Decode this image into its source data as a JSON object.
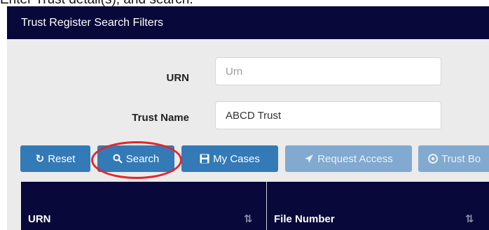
{
  "caption": "Enter Trust detail(s), and search.",
  "panel": {
    "title": "Trust Register Search Filters"
  },
  "filters": {
    "urn": {
      "label": "URN",
      "value": "",
      "placeholder": "Urn"
    },
    "trust_name": {
      "label": "Trust Name",
      "value": "ABCD Trust",
      "placeholder": ""
    }
  },
  "buttons": {
    "reset": "Reset",
    "search": "Search",
    "my_cases": "My Cases",
    "request_access": "Request Access",
    "trust_browse": "Trust Bo"
  },
  "table": {
    "columns": [
      "URN",
      "File Number"
    ]
  },
  "icons": {
    "reset": "refresh-icon",
    "search": "search-icon",
    "my_cases": "save-icon",
    "request_access": "send-icon",
    "trust_browse": "circle-icon",
    "urn_sort": "sort-numeric-icon",
    "file_sort": "sort-icon"
  },
  "colors": {
    "header_bg": "#08083a",
    "panel_bg": "#ebebeb",
    "primary": "#337ab7",
    "primary_disabled": "#82a9cf",
    "highlight": "#e3262e"
  }
}
